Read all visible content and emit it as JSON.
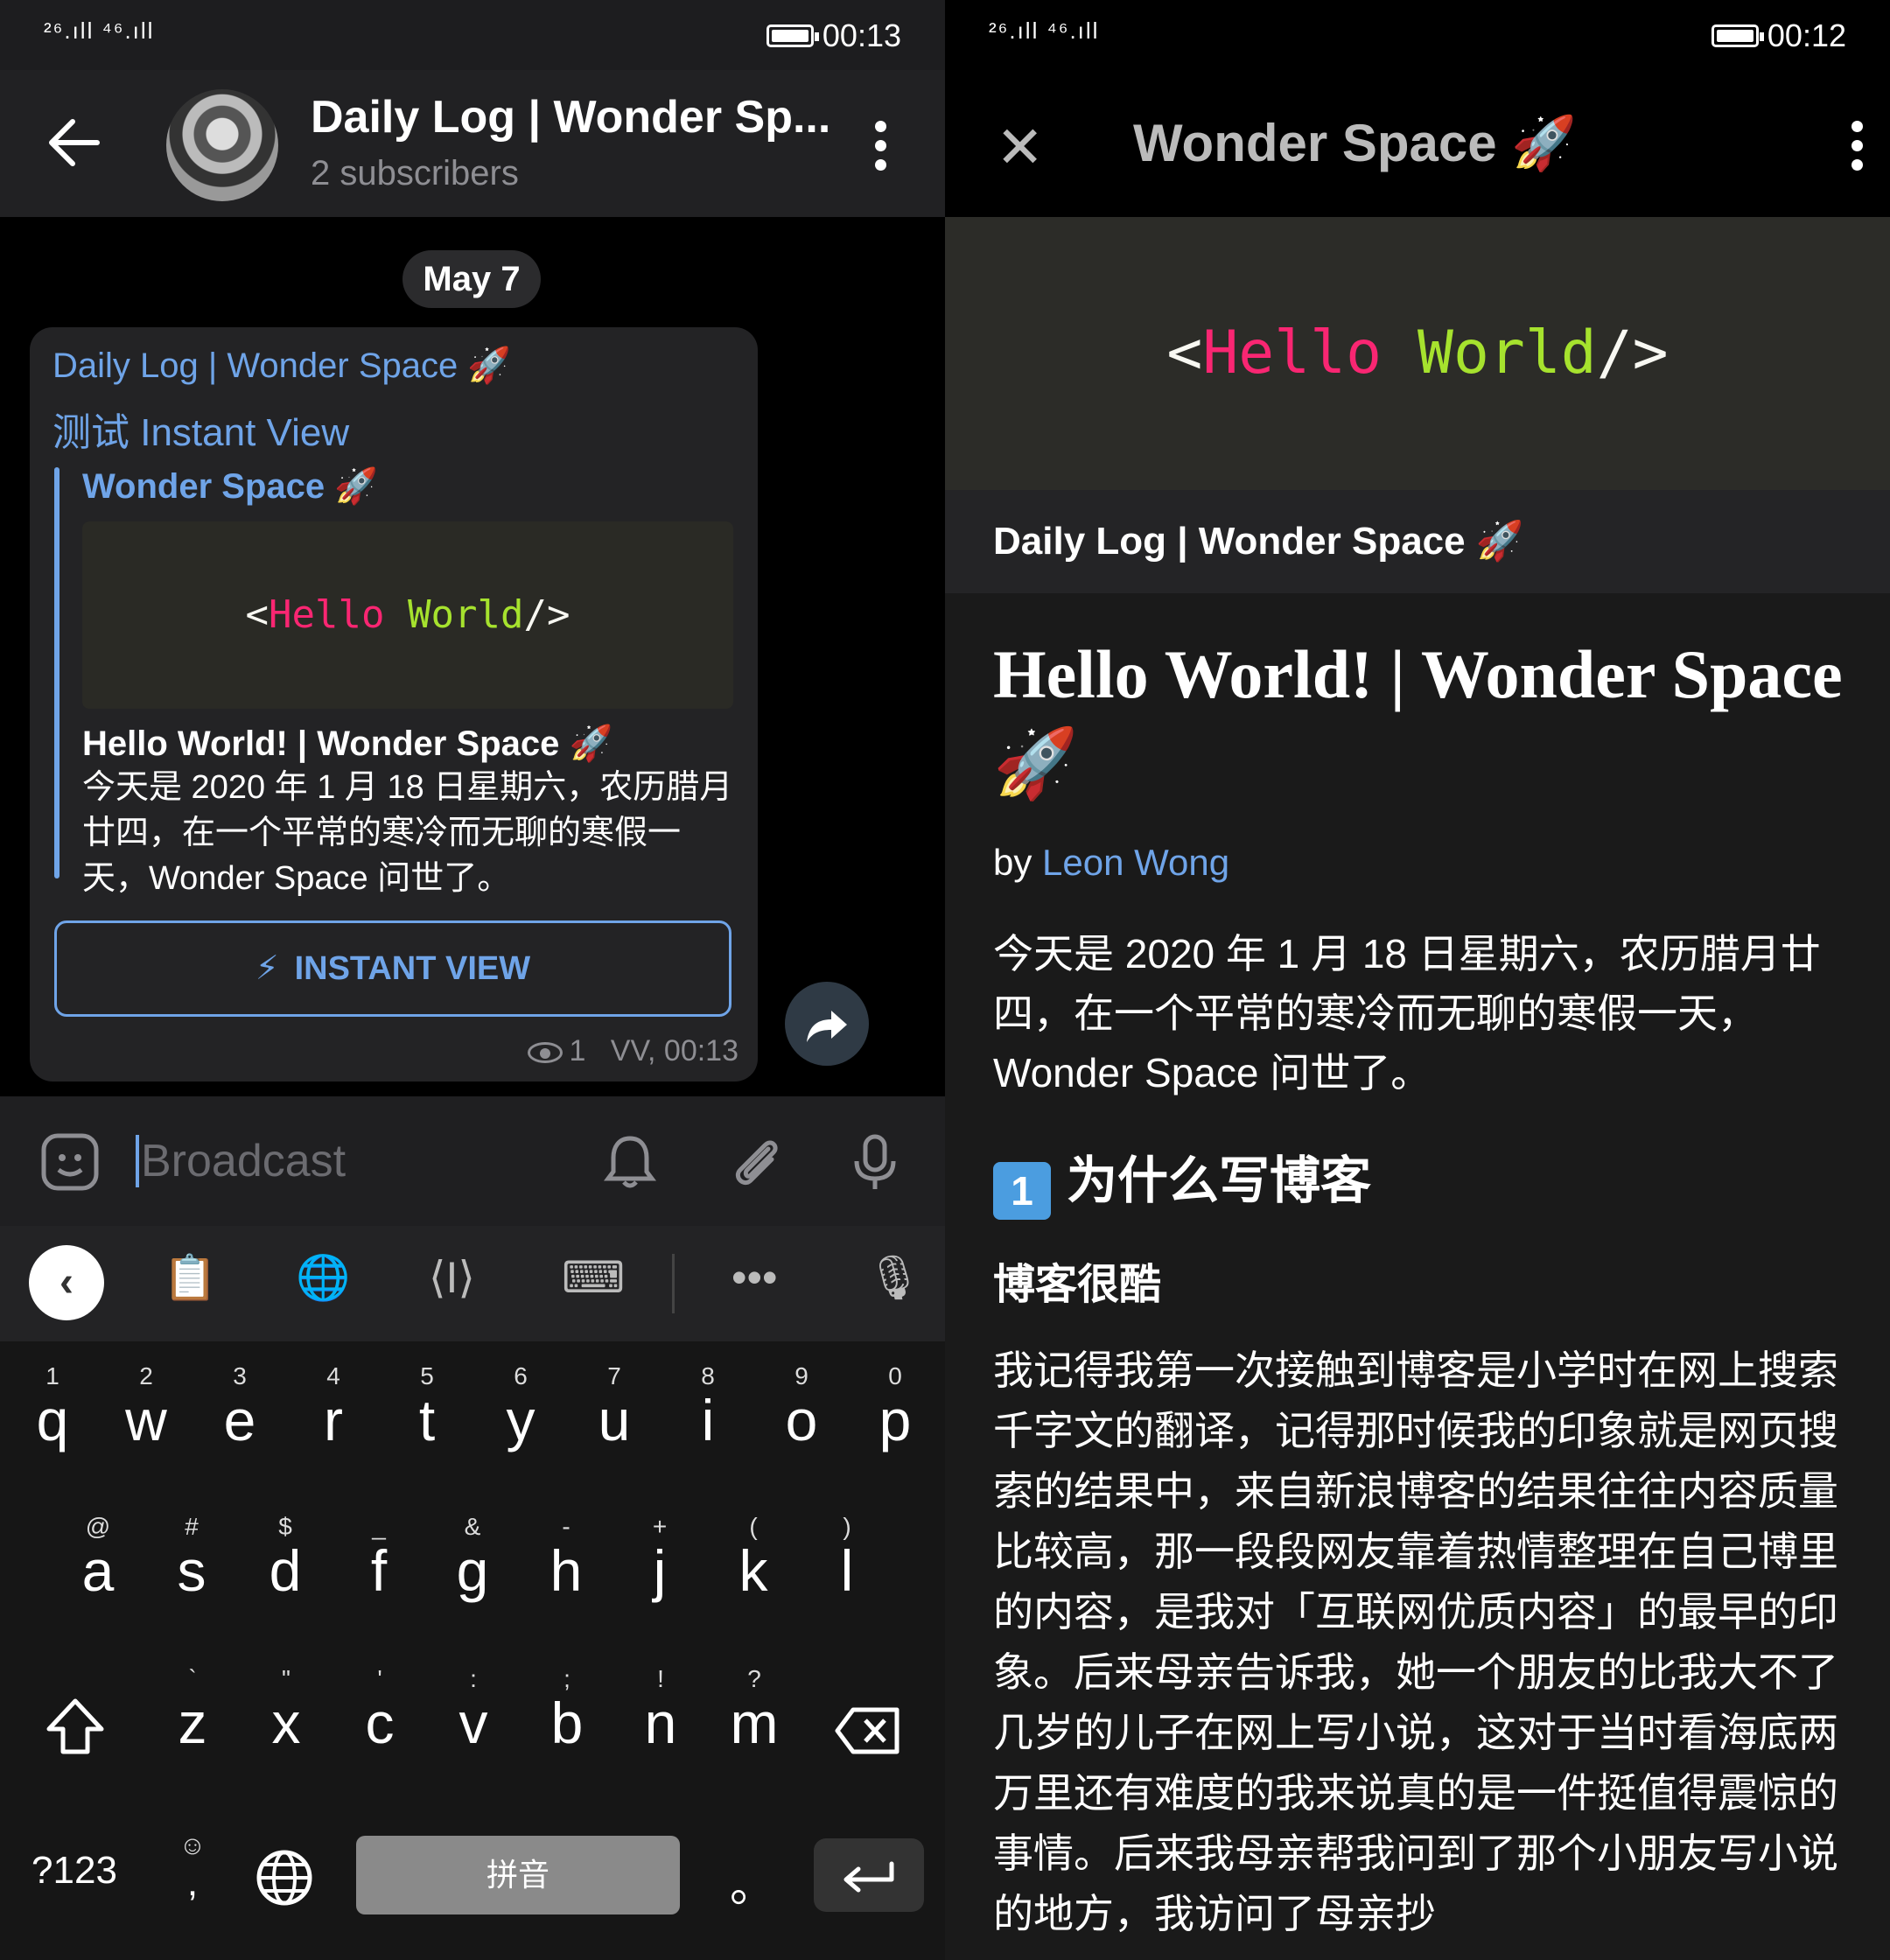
{
  "left": {
    "status_bar": {
      "signal": "²⁶.ıll ⁴⁶.ıll ",
      "time": "00:13"
    },
    "header": {
      "title": "Daily Log | Wonder Sp...",
      "subtitle": "2 subscribers"
    },
    "date_separator": "May 7",
    "message": {
      "channel_name": "Daily Log | Wonder Space 🚀",
      "text": "测试 Instant View",
      "preview": {
        "site_name": "Wonder Space 🚀",
        "code_parts": [
          "<",
          "Hello",
          " ",
          "World",
          "/>"
        ],
        "title": "Hello World! | Wonder Space 🚀",
        "description": "今天是 2020 年 1 月 18 日星期六，农历腊月廿四，在一个平常的寒冷而无聊的寒假一天，Wonder Space 问世了。"
      },
      "instant_view_label": "INSTANT VIEW",
      "views": "1",
      "meta": "VV, 00:13"
    },
    "input": {
      "placeholder": "Broadcast"
    },
    "keyboard": {
      "row1": [
        {
          "hint": "1",
          "key": "q"
        },
        {
          "hint": "2",
          "key": "w"
        },
        {
          "hint": "3",
          "key": "e"
        },
        {
          "hint": "4",
          "key": "r"
        },
        {
          "hint": "5",
          "key": "t"
        },
        {
          "hint": "6",
          "key": "y"
        },
        {
          "hint": "7",
          "key": "u"
        },
        {
          "hint": "8",
          "key": "i"
        },
        {
          "hint": "9",
          "key": "o"
        },
        {
          "hint": "0",
          "key": "p"
        }
      ],
      "row2": [
        {
          "hint": "@",
          "key": "a"
        },
        {
          "hint": "#",
          "key": "s"
        },
        {
          "hint": "$",
          "key": "d"
        },
        {
          "hint": "_",
          "key": "f"
        },
        {
          "hint": "&",
          "key": "g"
        },
        {
          "hint": "-",
          "key": "h"
        },
        {
          "hint": "+",
          "key": "j"
        },
        {
          "hint": "(",
          "key": "k"
        },
        {
          "hint": ")",
          "key": "l"
        }
      ],
      "row3": [
        {
          "hint": "`",
          "key": "z"
        },
        {
          "hint": "\"",
          "key": "x"
        },
        {
          "hint": "'",
          "key": "c"
        },
        {
          "hint": ":",
          "key": "v"
        },
        {
          "hint": ";",
          "key": "b"
        },
        {
          "hint": "!",
          "key": "n"
        },
        {
          "hint": "?",
          "key": "m"
        }
      ],
      "symbols_key": "?123",
      "emoji_hint": "☺",
      "comma_key": ",",
      "space_label": "拼音",
      "period_key": "。"
    }
  },
  "right": {
    "status_bar": {
      "signal": "²⁶.ıll ⁴⁶.ıll",
      "time": "00:12"
    },
    "header": {
      "title": "Wonder Space 🚀"
    },
    "cover_code_parts": [
      "<",
      "Hello",
      " ",
      "World",
      "/>"
    ],
    "channel": "Daily Log | Wonder Space 🚀",
    "article": {
      "title": "Hello World! | Wonder Space 🚀",
      "by_prefix": "by",
      "author": "Leon Wong",
      "intro": "今天是 2020 年 1 月 18 日星期六，农历腊月廿四，在一个平常的寒冷而无聊的寒假一天，Wonder Space 问世了。",
      "section_num": "1",
      "section_title": "为什么写博客",
      "subsection_title": "博客很酷",
      "body": "我记得我第一次接触到博客是小学时在网上搜索千字文的翻译，记得那时候我的印象就是网页搜索的结果中，来自新浪博客的结果往往内容质量比较高，那一段段网友靠着热情整理在自己博里的内容，是我对「互联网优质内容」的最早的印象。后来母亲告诉我，她一个朋友的比我大不了几岁的儿子在网上写小说，这对于当时看海底两万里还有难度的我来说真的是一件挺值得震惊的事情。后来我母亲帮我问到了那个小朋友写小说的地方，我访问了母亲抄"
    }
  }
}
